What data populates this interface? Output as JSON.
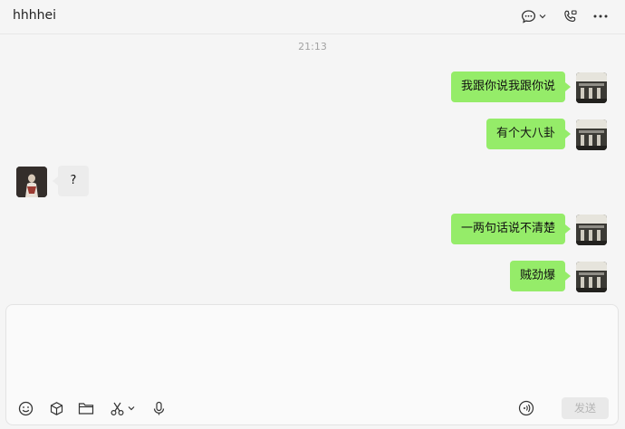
{
  "header": {
    "title": "hhhhei",
    "icons": [
      "chat-bubble-icon",
      "chevron-down-icon",
      "voice-call-icon",
      "more-icon"
    ]
  },
  "chat": {
    "timestamp": "21:13",
    "messages": [
      {
        "from": "me",
        "text": "我跟你说我跟你说"
      },
      {
        "from": "me",
        "text": "有个大八卦"
      },
      {
        "from": "them",
        "text": "?"
      },
      {
        "from": "me",
        "text": "一两句话说不清楚"
      },
      {
        "from": "me",
        "text": "贼劲爆"
      }
    ]
  },
  "toolbar": {
    "icons": [
      "emoji-icon",
      "cube-icon",
      "folder-icon",
      "scissors-icon",
      "chevron-down-icon",
      "microphone-icon",
      "voice-input-icon"
    ],
    "send_label": "发送"
  },
  "colors": {
    "my_bubble": "#95ec69",
    "their_bubble": "#ececec",
    "background": "#f5f5f5"
  }
}
